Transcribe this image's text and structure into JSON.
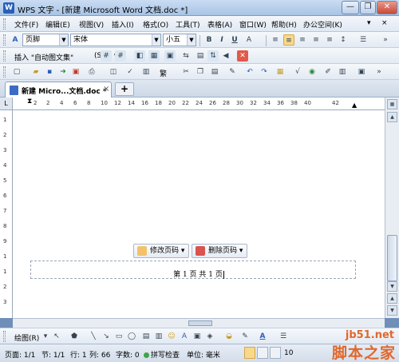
{
  "window": {
    "title": "WPS 文字 - [新建 Microsoft Word 文档.doc *]",
    "app_icon": "W",
    "buttons": {
      "minimize": "—",
      "restore": "❐",
      "close": "✕"
    }
  },
  "menu": {
    "items": [
      "文件(F)",
      "编辑(E)",
      "视图(V)",
      "插入(I)",
      "格式(O)",
      "工具(T)",
      "表格(A)",
      "窗口(W)",
      "帮助(H)",
      "办公空间(K)"
    ],
    "right_controls": [
      "▾",
      "×"
    ]
  },
  "format_toolbar": {
    "style_value": "页脚",
    "font_value": "宋体",
    "size_value": "小五",
    "bold": "B",
    "italic": "I",
    "underline": "U"
  },
  "insert_toolbar": {
    "autotext_label": "插入 \"自动图文集\"",
    "autotext_arrow": "(S)"
  },
  "standard_toolbar": {
    "traditional_label": "繁"
  },
  "tabs": {
    "doc_tab_label": "新建 Micro...文档.doc *",
    "close": "×",
    "new_tab": "+"
  },
  "ruler": {
    "corner": "L",
    "h_ticks": [
      "2",
      "2",
      "4",
      "6",
      "8",
      "10",
      "12",
      "14",
      "16",
      "18",
      "20",
      "22",
      "24",
      "26",
      "28",
      "30",
      "32",
      "34",
      "36",
      "38",
      "40",
      "42"
    ],
    "v_ticks": [
      "1",
      "2",
      "3",
      "4",
      "5",
      "6",
      "7",
      "8",
      "9",
      "1",
      "1",
      "2",
      "3"
    ]
  },
  "document": {
    "footer_text": "第 1 页 共 1 页",
    "edit_page_number_button": "修改页码",
    "delete_page_number_button": "删除页码"
  },
  "drawing_toolbar": {
    "draw_label": "绘图(R)"
  },
  "status": {
    "page": "页面: 1/1",
    "section": "节: 1/1",
    "line": "行: 1",
    "column": "列: 66",
    "word_count": "字数: 0",
    "spell_check": "拼写检查",
    "unit": "单位: 毫米",
    "zoom": "10"
  },
  "watermark": {
    "url": "jb51.net",
    "text": "脚本之家"
  },
  "colors": {
    "accent": "#f8d98c",
    "title_bar": "#a8c4e6",
    "watermark": "#e1672b"
  }
}
